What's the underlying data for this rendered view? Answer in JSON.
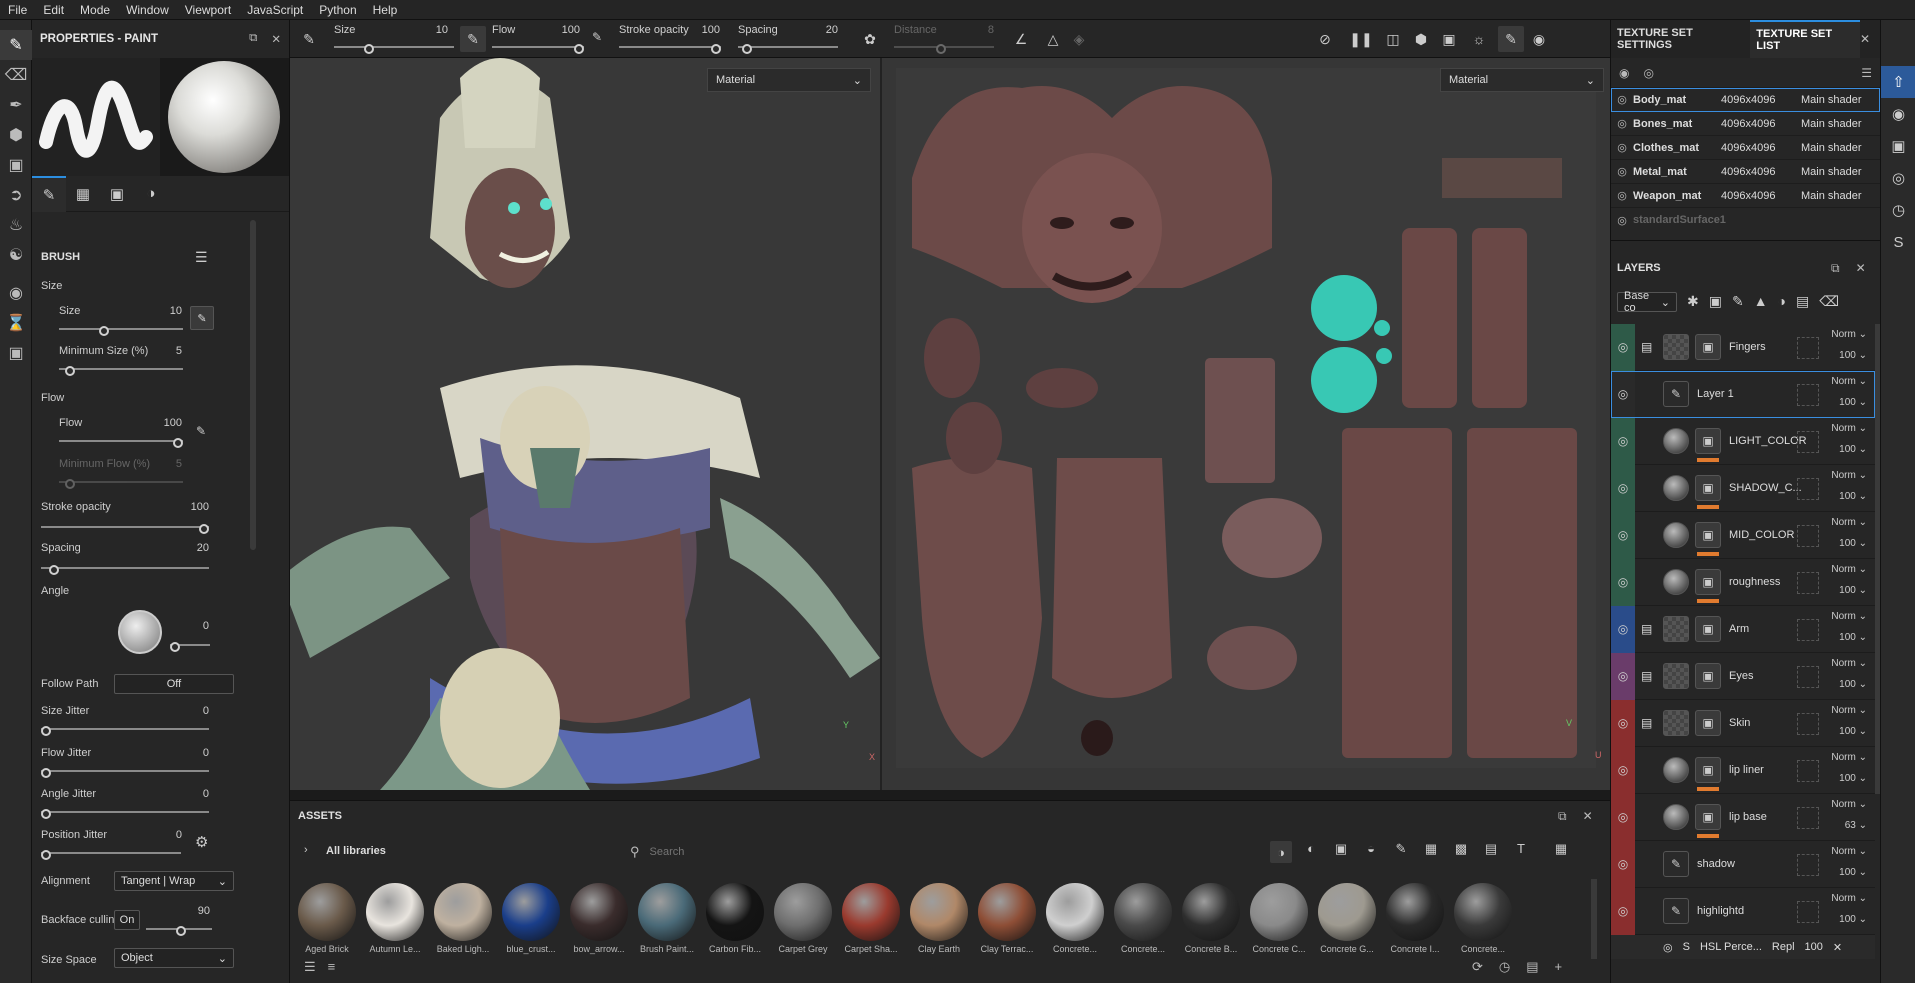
{
  "menu": [
    "File",
    "Edit",
    "Mode",
    "Window",
    "Viewport",
    "JavaScript",
    "Python",
    "Help"
  ],
  "properties": {
    "title": "PROPERTIES - PAINT",
    "brush_section": "BRUSH",
    "size_group": "Size",
    "size_label": "Size",
    "size_value": "10",
    "min_size_label": "Minimum Size (%)",
    "min_size_value": "5",
    "flow_group": "Flow",
    "flow_label": "Flow",
    "flow_value": "100",
    "min_flow_label": "Minimum Flow (%)",
    "min_flow_value": "5",
    "stroke_opacity_label": "Stroke opacity",
    "stroke_opacity_value": "100",
    "spacing_label": "Spacing",
    "spacing_value": "20",
    "angle_label": "Angle",
    "angle_value": "0",
    "follow_path_label": "Follow Path",
    "follow_path_value": "Off",
    "size_jitter_label": "Size Jitter",
    "size_jitter_value": "0",
    "flow_jitter_label": "Flow Jitter",
    "flow_jitter_value": "0",
    "angle_jitter_label": "Angle Jitter",
    "angle_jitter_value": "0",
    "position_jitter_label": "Position Jitter",
    "position_jitter_value": "0",
    "alignment_label": "Alignment",
    "alignment_value": "Tangent | Wrap",
    "backface_label": "Backface culling",
    "backface_toggle": "On",
    "backface_value": "90",
    "size_space_label": "Size Space",
    "size_space_value": "Object"
  },
  "toolbar": {
    "size_label": "Size",
    "size_value": "10",
    "flow_label": "Flow",
    "flow_value": "100",
    "stroke_label": "Stroke opacity",
    "stroke_value": "100",
    "spacing_label": "Spacing",
    "spacing_value": "20",
    "distance_label": "Distance",
    "distance_value": "8"
  },
  "viewport": {
    "left_mode": "Material",
    "right_mode": "Material",
    "axis_y": "Y",
    "axis_x": "X",
    "axis_v": "V",
    "axis_u": "U"
  },
  "assets": {
    "title": "ASSETS",
    "libraries": "All libraries",
    "search_placeholder": "Search",
    "items": [
      {
        "label": "Aged Brick",
        "color": "#6a5a4a"
      },
      {
        "label": "Autumn Le...",
        "color": "#e8e4de"
      },
      {
        "label": "Baked Ligh...",
        "color": "#bfb1a0"
      },
      {
        "label": "blue_crust...",
        "color": "#1a3e8a"
      },
      {
        "label": "bow_arrow...",
        "color": "#3a2c2c"
      },
      {
        "label": "Brush Paint...",
        "color": "#4a6a78"
      },
      {
        "label": "Carbon Fib...",
        "color": "#141414"
      },
      {
        "label": "Carpet Grey",
        "color": "#6e6e6e"
      },
      {
        "label": "Carpet Sha...",
        "color": "#9a3a2e"
      },
      {
        "label": "Clay Earth",
        "color": "#b08868"
      },
      {
        "label": "Clay Terrac...",
        "color": "#8e4e36"
      },
      {
        "label": "Concrete...",
        "color": "#cfcfcf"
      },
      {
        "label": "Concrete...",
        "color": "#4a4a4a"
      },
      {
        "label": "Concrete B...",
        "color": "#2e2e2e"
      },
      {
        "label": "Concrete C...",
        "color": "#8a8a8a"
      },
      {
        "label": "Concrete G...",
        "color": "#9e9a90"
      },
      {
        "label": "Concrete I...",
        "color": "#2a2a2a"
      },
      {
        "label": "Concrete...",
        "color": "#3a3a3a"
      }
    ]
  },
  "texture_sets": {
    "tab1": "TEXTURE SET SETTINGS",
    "tab2": "TEXTURE SET LIST",
    "rows": [
      {
        "name": "Body_mat",
        "res": "4096x4096",
        "shader": "Main shader"
      },
      {
        "name": "Bones_mat",
        "res": "4096x4096",
        "shader": "Main shader"
      },
      {
        "name": "Clothes_mat",
        "res": "4096x4096",
        "shader": "Main shader"
      },
      {
        "name": "Metal_mat",
        "res": "4096x4096",
        "shader": "Main shader"
      },
      {
        "name": "Weapon_mat",
        "res": "4096x4096",
        "shader": "Main shader"
      }
    ],
    "extra": "standardSurface1"
  },
  "layers": {
    "title": "LAYERS",
    "channel": "Base co",
    "items": [
      {
        "name": "Fingers",
        "blend": "Norm",
        "opacity": "100",
        "color": "#2e5a48",
        "type": "folder"
      },
      {
        "name": "Layer 1",
        "blend": "Norm",
        "opacity": "100",
        "color": "#2a2a2a",
        "type": "paint"
      },
      {
        "name": "LIGHT_COLOR",
        "blend": "Norm",
        "opacity": "100",
        "color": "#2e5a48",
        "type": "fill"
      },
      {
        "name": "SHADOW_C...",
        "blend": "Norm",
        "opacity": "100",
        "color": "#2e5a48",
        "type": "fill"
      },
      {
        "name": "MID_COLOR",
        "blend": "Norm",
        "opacity": "100",
        "color": "#2e5a48",
        "type": "fill"
      },
      {
        "name": "roughness",
        "blend": "Norm",
        "opacity": "100",
        "color": "#2e5a48",
        "type": "fill"
      },
      {
        "name": "Arm",
        "blend": "Norm",
        "opacity": "100",
        "color": "#2a4c8a",
        "type": "folder"
      },
      {
        "name": "Eyes",
        "blend": "Norm",
        "opacity": "100",
        "color": "#6a3c6a",
        "type": "folder"
      },
      {
        "name": "Skin",
        "blend": "Norm",
        "opacity": "100",
        "color": "#8a2e2e",
        "type": "folder"
      },
      {
        "name": "lip liner",
        "blend": "Norm",
        "opacity": "100",
        "color": "#8a2e2e",
        "type": "fill"
      },
      {
        "name": "lip base",
        "blend": "Norm",
        "opacity": "63",
        "color": "#8a2e2e",
        "type": "fill"
      },
      {
        "name": "shadow",
        "blend": "Norm",
        "opacity": "100",
        "color": "#8a2e2e",
        "type": "paint"
      },
      {
        "name": "highlightd",
        "blend": "Norm",
        "opacity": "100",
        "color": "#8a2e2e",
        "type": "paint"
      }
    ],
    "filter_name": "HSL Perce...",
    "filter_blend": "Repl",
    "filter_opacity": "100"
  }
}
